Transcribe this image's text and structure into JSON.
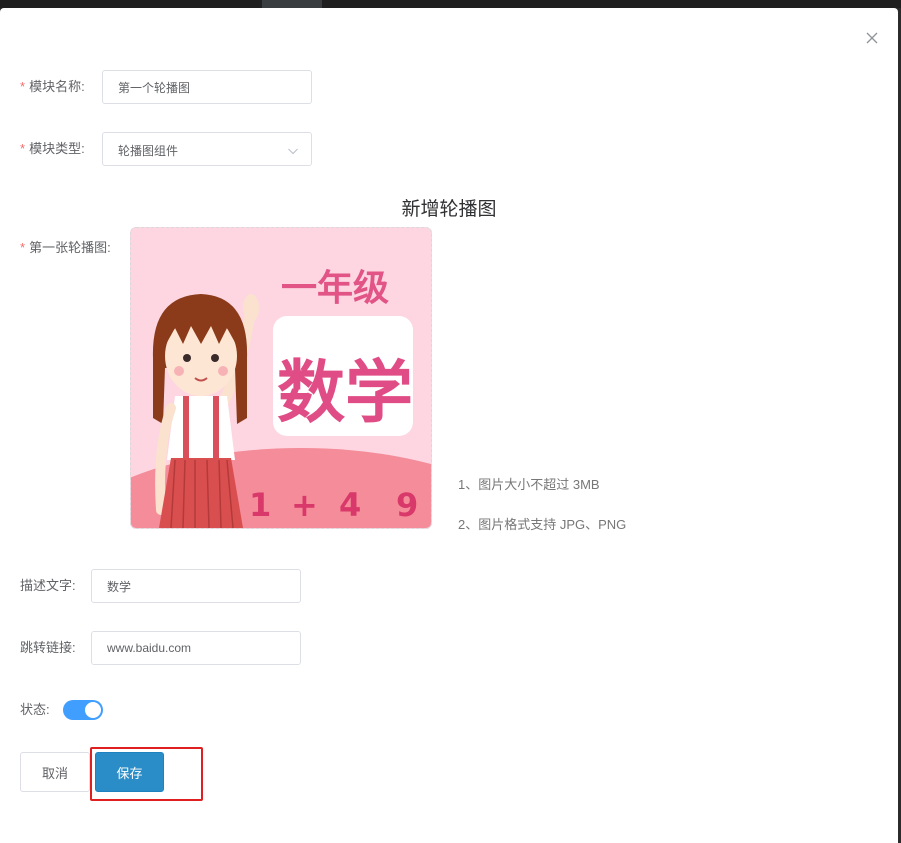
{
  "dialog": {
    "close_icon": "close-icon"
  },
  "form": {
    "module_name": {
      "label": "模块名称:",
      "required": "*",
      "value": "第一个轮播图"
    },
    "module_type": {
      "label": "模块类型:",
      "required": "*",
      "selected": "轮播图组件"
    },
    "section_title": "新增轮播图",
    "first_slide": {
      "label": "第一张轮播图:",
      "required": "*"
    },
    "image": {
      "line1": "一年级",
      "line2": "数学",
      "digits": [
        "1",
        "+",
        "4",
        "9"
      ]
    },
    "hints": [
      "1、图片大小不超过 3MB",
      "2、图片格式支持 JPG、PNG"
    ],
    "description": {
      "label": "描述文字:",
      "value": "数学"
    },
    "link": {
      "label": "跳转链接:",
      "value": "www.baidu.com"
    },
    "status": {
      "label": "状态:",
      "on": true
    }
  },
  "buttons": {
    "cancel": "取消",
    "save": "保存"
  },
  "colors": {
    "primary": "#2b8dc8",
    "switch_on": "#409eff",
    "required": "#f56c6c",
    "highlight": "#e02020"
  }
}
